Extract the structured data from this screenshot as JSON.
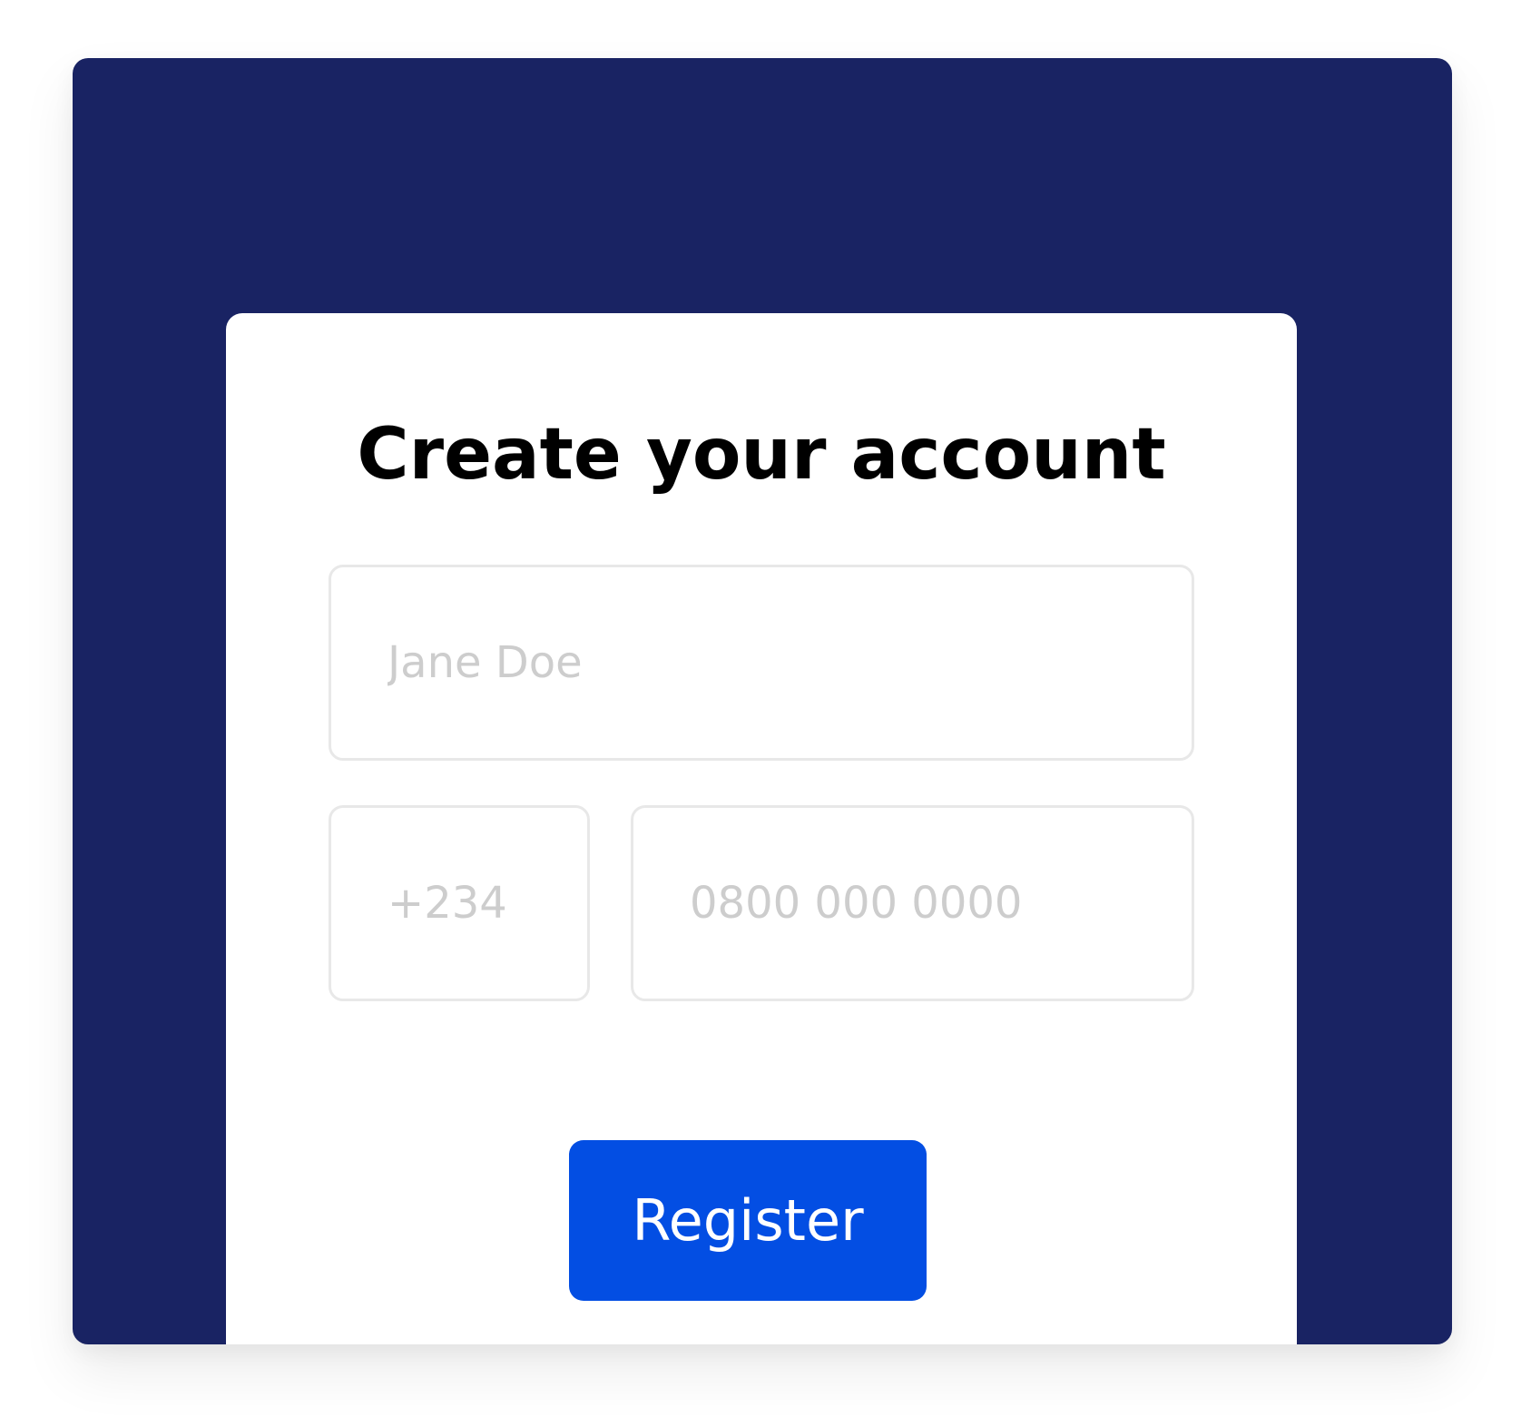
{
  "form": {
    "title": "Create your account",
    "name_placeholder": "Jane Doe",
    "country_code_placeholder": "+234",
    "phone_placeholder": "0800 000 0000",
    "register_label": "Register"
  },
  "colors": {
    "frame_background": "#192363",
    "card_background": "#ffffff",
    "button_background": "#034ee3",
    "button_text": "#ffffff",
    "placeholder_text": "#cdcdcd",
    "field_border": "#e8e8e8"
  }
}
